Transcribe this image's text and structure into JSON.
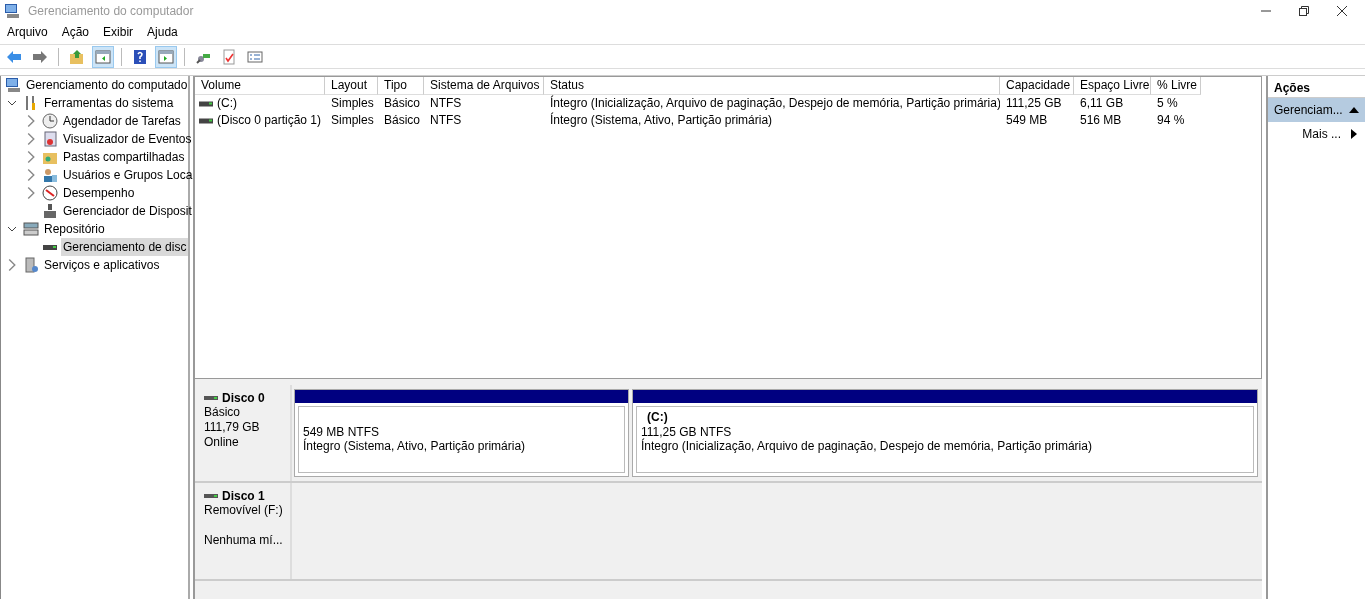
{
  "window": {
    "title": "Gerenciamento do computador"
  },
  "menu": [
    "Arquivo",
    "Ação",
    "Exibir",
    "Ajuda"
  ],
  "toolbar": [
    {
      "kind": "button",
      "pressed": false
    },
    {
      "kind": "button",
      "pressed": false
    },
    {
      "kind": "separator"
    },
    {
      "kind": "button",
      "pressed": false
    },
    {
      "kind": "button",
      "pressed": true
    },
    {
      "kind": "separator"
    },
    {
      "kind": "button",
      "pressed": false
    },
    {
      "kind": "button",
      "pressed": true
    },
    {
      "kind": "separator"
    },
    {
      "kind": "button",
      "pressed": false
    },
    {
      "kind": "button",
      "pressed": false
    },
    {
      "kind": "button",
      "pressed": false
    }
  ],
  "tree": [
    {
      "label": "Gerenciamento do computado",
      "selected": false,
      "children": [
        {
          "label": "Ferramentas do sistema",
          "expanded": true,
          "selected": false,
          "children": [
            {
              "label": "Agendador de Tarefas",
              "expanded": false,
              "selected": false
            },
            {
              "label": "Visualizador de Eventos",
              "expanded": false,
              "selected": false
            },
            {
              "label": "Pastas compartilhadas",
              "expanded": false,
              "selected": false
            },
            {
              "label": "Usuários e Grupos Loca",
              "expanded": false,
              "selected": false
            },
            {
              "label": "Desempenho",
              "expanded": false,
              "selected": false
            },
            {
              "label": "Gerenciador de Disposit",
              "selected": false
            }
          ]
        },
        {
          "label": "Repositório",
          "expanded": true,
          "selected": false,
          "children": [
            {
              "label": "Gerenciamento de disc",
              "selected": true
            }
          ]
        },
        {
          "label": "Serviços e aplicativos",
          "expanded": false,
          "selected": false
        }
      ]
    }
  ],
  "table": {
    "columns": [
      "Volume",
      "Layout",
      "Tipo",
      "Sistema de Arquivos",
      "Status",
      "Capacidade",
      "Espaço Livre",
      "% Livre"
    ],
    "rows": [
      [
        "(C:)",
        "Simples",
        "Básico",
        "NTFS",
        "Íntegro (Inicialização, Arquivo de paginação, Despejo de memória, Partição primária)",
        "111,25 GB",
        "6,11 GB",
        "5 %"
      ],
      [
        "(Disco 0 partição 1)",
        "Simples",
        "Básico",
        "NTFS",
        "Íntegro (Sistema, Ativo, Partição primária)",
        "549 MB",
        "516 MB",
        "94 %"
      ]
    ]
  },
  "disks": [
    {
      "name": "Disco 0",
      "lines": [
        "Básico",
        "111,79 GB"
      ],
      "status": "Online",
      "partitions": [
        {
          "size": "549 MB NTFS",
          "status": "Íntegro (Sistema, Ativo, Partição primária)"
        },
        {
          "label": "(C:)",
          "size": "111,25 GB NTFS",
          "status": "Íntegro (Inicialização, Arquivo de paginação, Despejo de memória, Partição primária)"
        }
      ]
    },
    {
      "name": "Disco 1",
      "lines": [
        "Removível (F:)"
      ],
      "status": "Nenhuma mí..."
    }
  ],
  "actions": {
    "title": "Ações",
    "items": [
      {
        "label": "Gerenciam...",
        "kind": "group",
        "selected": true
      },
      {
        "label": "Mais ...",
        "kind": "submenu",
        "selected": false
      }
    ]
  }
}
